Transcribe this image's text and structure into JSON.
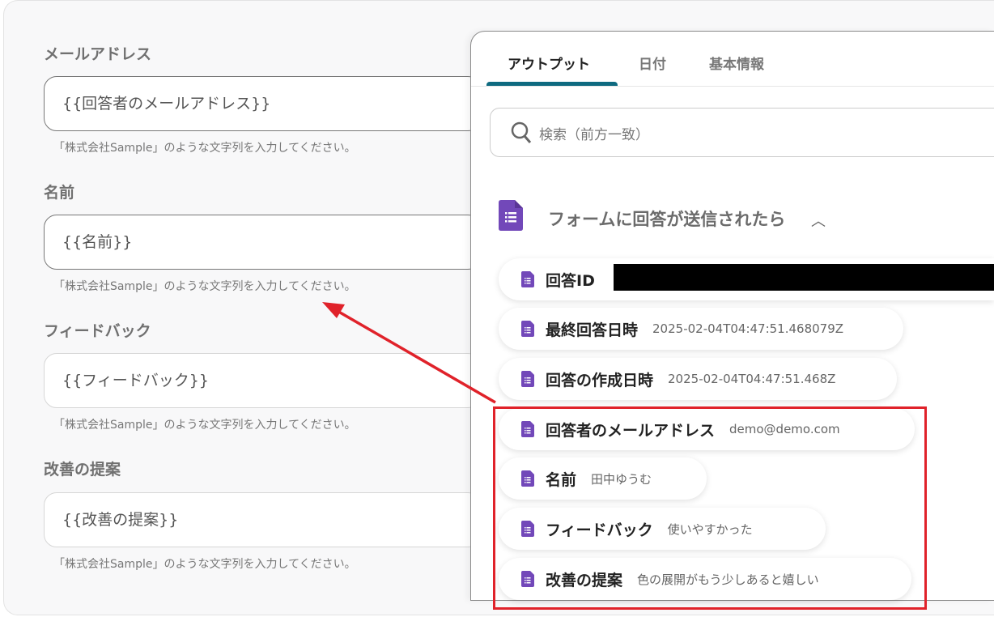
{
  "form": {
    "fields": [
      {
        "label": "メールアドレス",
        "value": "{{回答者のメールアドレス}}",
        "hint": "「株式会社Sample」のような文字列を入力してください。"
      },
      {
        "label": "名前",
        "value": "{{名前}}",
        "hint": "「株式会社Sample」のような文字列を入力してください。"
      },
      {
        "label": "フィードバック",
        "value": "{{フィードバック}}",
        "hint": "「株式会社Sample」のような文字列を入力してください。"
      },
      {
        "label": "改善の提案",
        "value": "{{改善の提案}}",
        "hint": "「株式会社Sample」のような文字列を入力してください。"
      }
    ]
  },
  "panel": {
    "tabs": [
      "アウトプット",
      "日付",
      "基本情報"
    ],
    "search_placeholder": "検索（前方一致）",
    "section_title": "フォームに回答が送信されたら",
    "items": [
      {
        "key": "回答ID",
        "value": ""
      },
      {
        "key": "最終回答日時",
        "value": "2025-02-04T04:47:51.468079Z"
      },
      {
        "key": "回答の作成日時",
        "value": "2025-02-04T04:47:51.468Z"
      },
      {
        "key": "回答者のメールアドレス",
        "value": "demo@demo.com"
      },
      {
        "key": "名前",
        "value": "田中ゆうむ"
      },
      {
        "key": "フィードバック",
        "value": "使いやすかった"
      },
      {
        "key": "改善の提案",
        "value": "色の展開がもう少しあると嬉しい"
      }
    ]
  },
  "colors": {
    "accent": "#0e6a80",
    "forms_icon": "#7248b9",
    "highlight": "#e0222a"
  }
}
